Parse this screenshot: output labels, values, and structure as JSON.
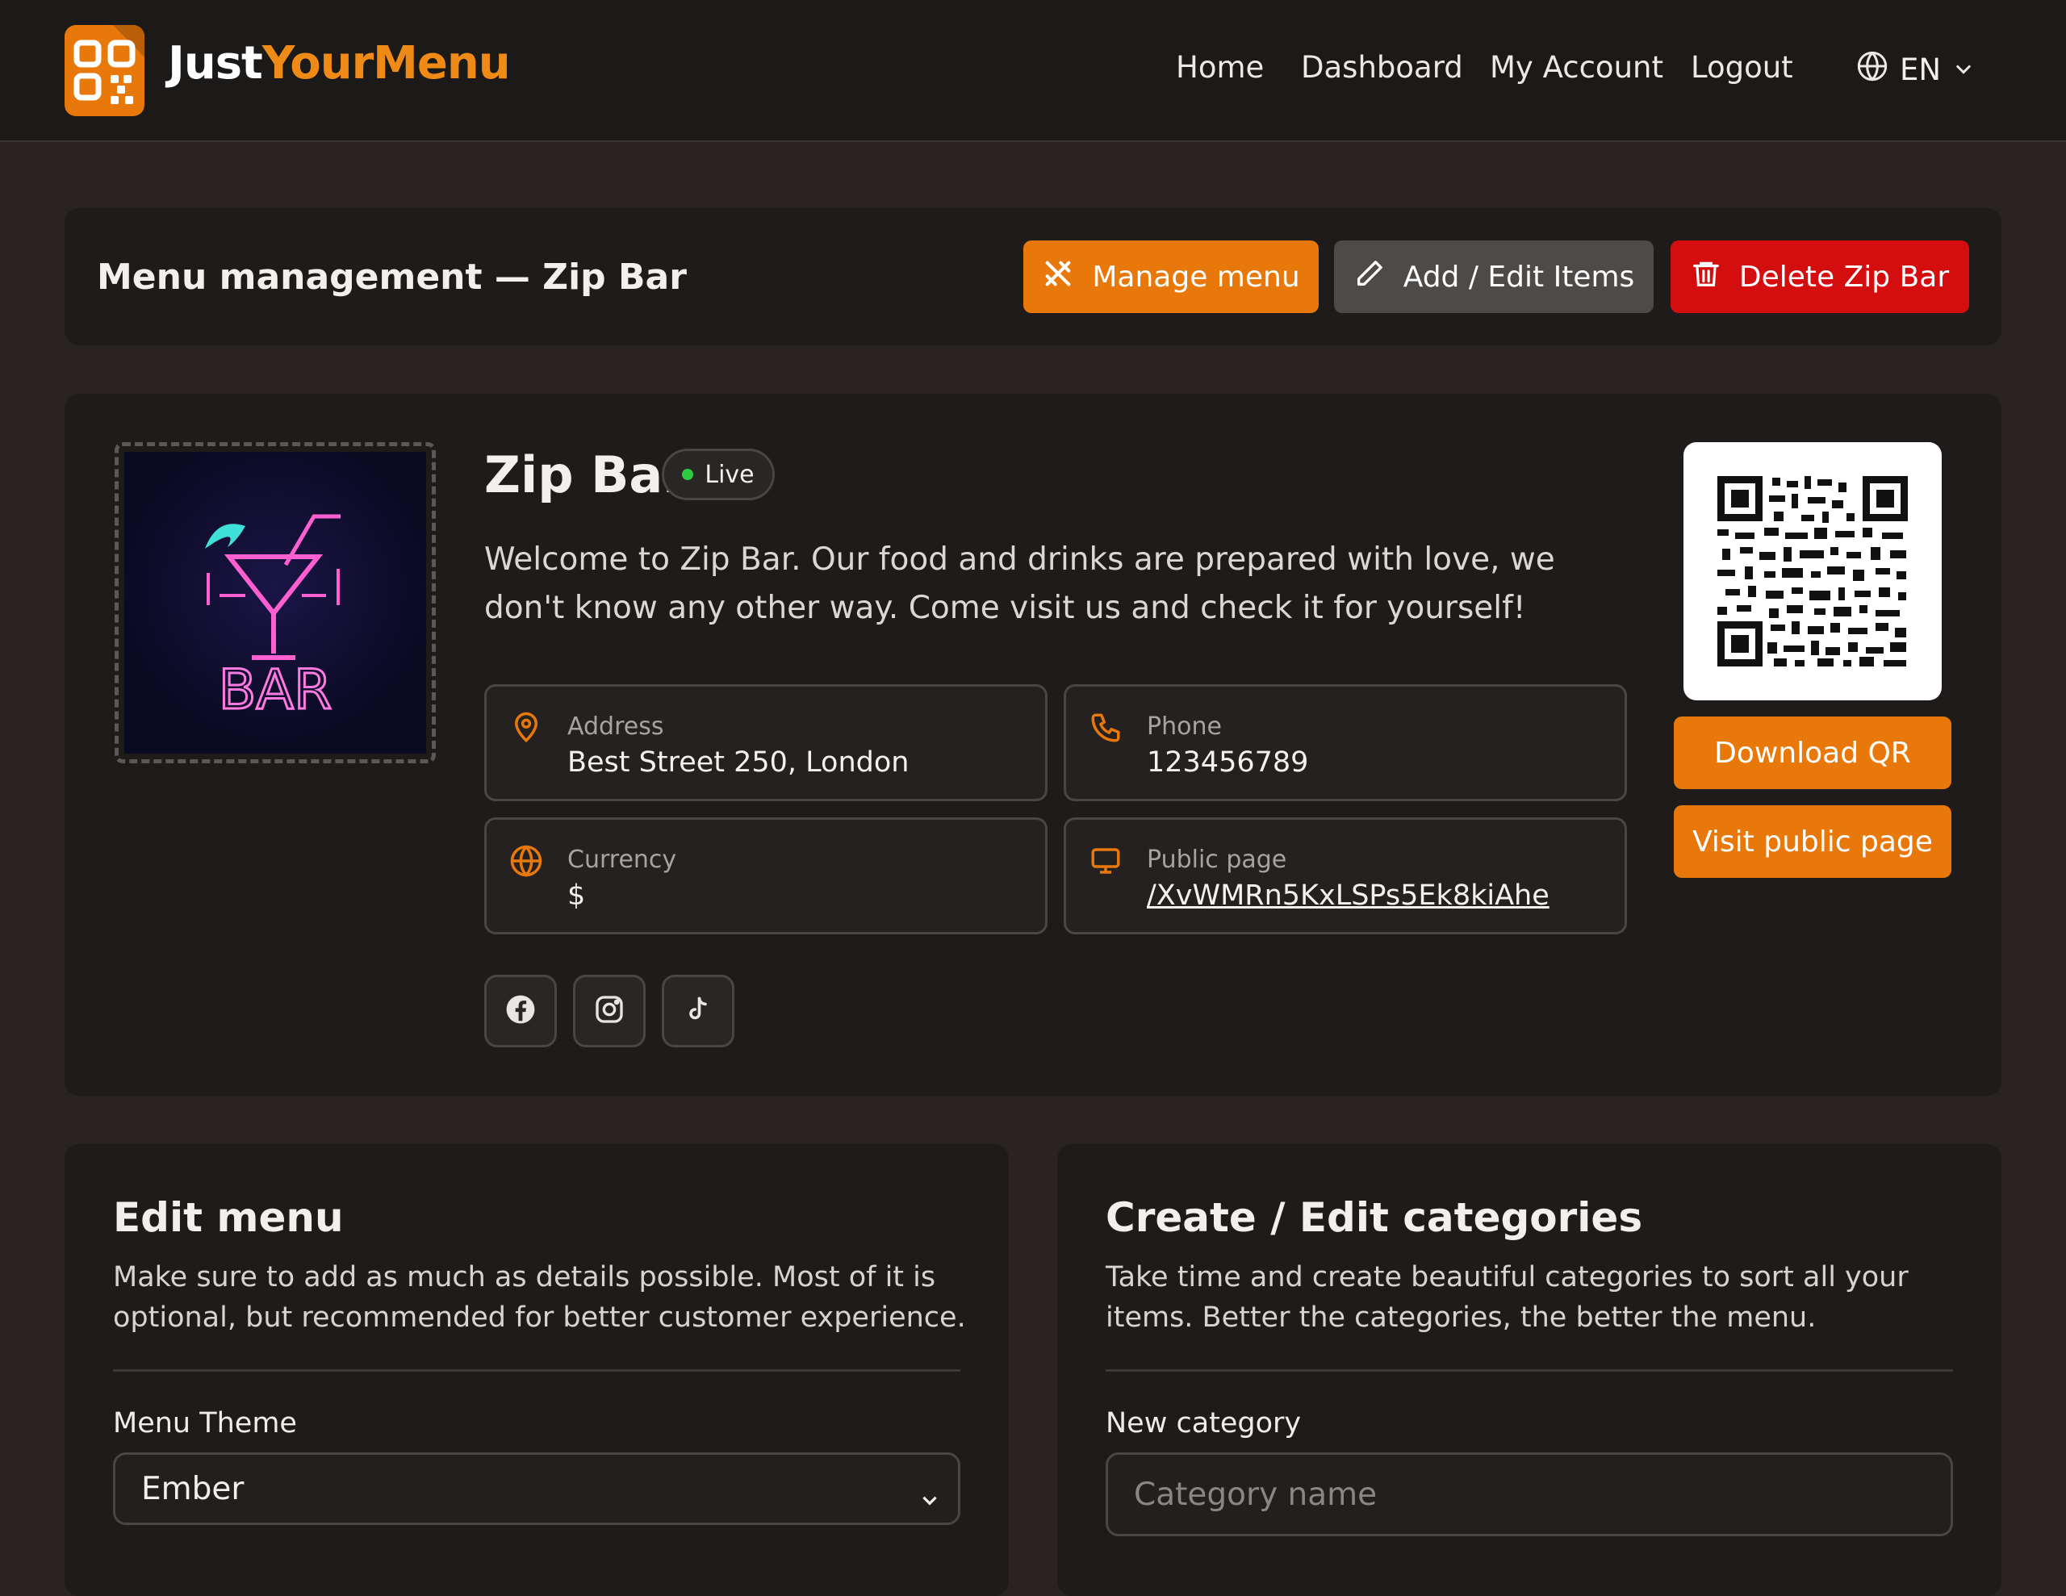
{
  "brand": {
    "name_part1": "Just",
    "name_part2": "YourMenu"
  },
  "nav": {
    "items": [
      "Home",
      "Dashboard",
      "My Account",
      "Logout"
    ],
    "language": "EN"
  },
  "management": {
    "title": "Menu management — Zip Bar",
    "manage_menu_label": "Manage menu",
    "add_edit_items_label": "Add / Edit Items",
    "delete_label": "Delete Zip Bar"
  },
  "venue": {
    "name": "Zip Bar",
    "status": "Live",
    "logo_text": "BAR",
    "description": "Welcome to Zip Bar. Our food and drinks are prepared with love, we don't know any other way. Come visit us and check it for yourself!",
    "address": {
      "label": "Address",
      "value": "Best Street 250, London"
    },
    "phone": {
      "label": "Phone",
      "value": "123456789"
    },
    "currency": {
      "label": "Currency",
      "value": "$"
    },
    "public_page": {
      "label": "Public page",
      "value": "/XvWMRn5KxLSPs5Ek8kiAhe"
    },
    "social_icons": [
      "facebook-icon",
      "instagram-icon",
      "tiktok-icon"
    ]
  },
  "qr": {
    "download_label": "Download QR",
    "visit_label": "Visit public page"
  },
  "edit_menu": {
    "title": "Edit menu",
    "description": "Make sure to add as much as details possible. Most of it is optional, but recommended for better customer experience.",
    "theme_label": "Menu Theme",
    "theme_value": "Ember"
  },
  "categories": {
    "title": "Create / Edit categories",
    "description": "Take time and create beautiful categories to sort all your items. Better the categories, the better the menu.",
    "new_label": "New category",
    "placeholder": "Category name"
  },
  "colors": {
    "accent": "#e8780a",
    "danger": "#d40d0f",
    "live": "#2ecc40",
    "background": "#292423",
    "card": "#1e1b1a"
  }
}
